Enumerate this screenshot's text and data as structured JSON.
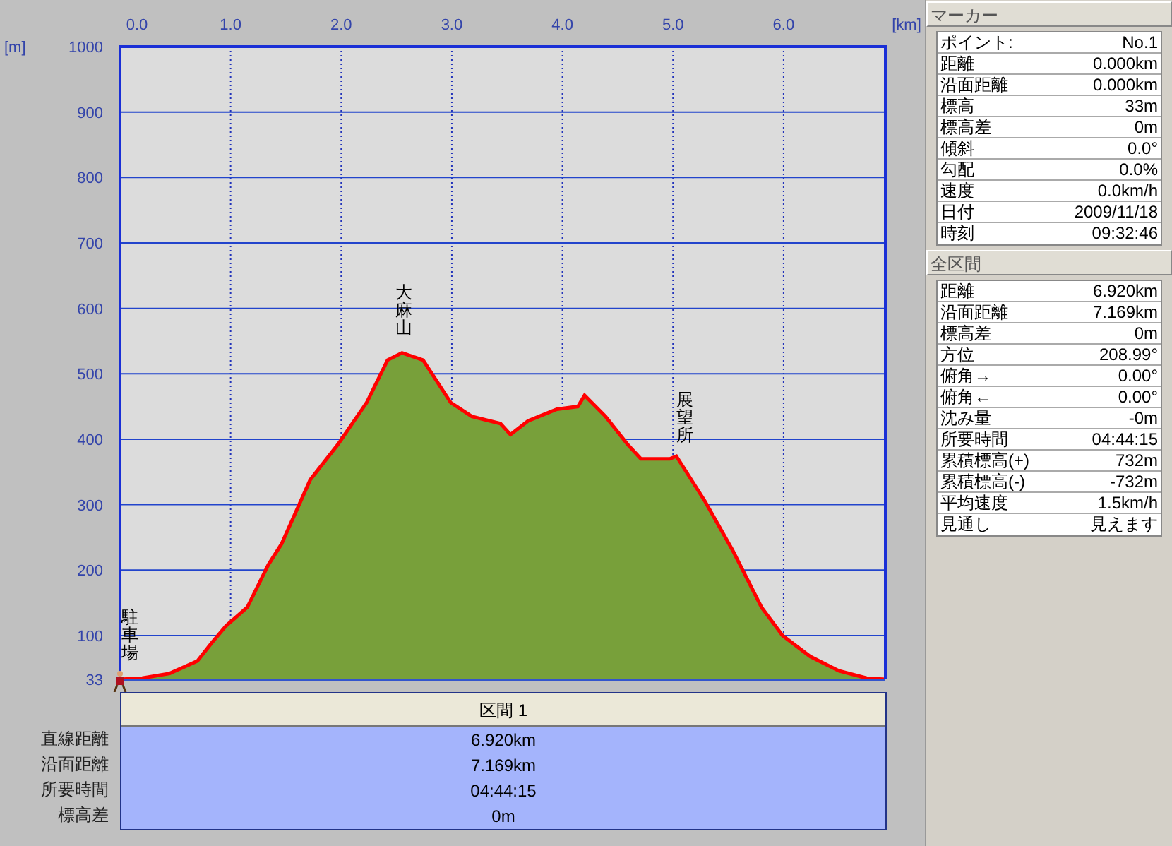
{
  "chart": {
    "chart_data": {
      "type": "area",
      "xlabel": "[km]",
      "ylabel": "[m]",
      "x": [
        0,
        0.2,
        0.45,
        0.7,
        0.83,
        0.96,
        1.15,
        1.34,
        1.46,
        1.72,
        1.97,
        2.23,
        2.42,
        2.55,
        2.74,
        2.99,
        3.18,
        3.44,
        3.53,
        3.69,
        3.95,
        4.14,
        4.2,
        4.39,
        4.59,
        4.71,
        4.97,
        5.03,
        5.29,
        5.54,
        5.8,
        5.99,
        6.24,
        6.5,
        6.75,
        6.92
      ],
      "series": [
        {
          "values": [
            33,
            35,
            42,
            61,
            89,
            115,
            143,
            208,
            240,
            338,
            392,
            456,
            521,
            532,
            521,
            456,
            435,
            424,
            407,
            428,
            446,
            450,
            467,
            435,
            392,
            370,
            370,
            374,
            305,
            230,
            143,
            100,
            68,
            46,
            35,
            33
          ]
        }
      ],
      "xlim": [
        0,
        6.92
      ],
      "ylim": [
        33,
        1000
      ],
      "xticks": [
        {
          "value": 0,
          "label": "0.0"
        },
        {
          "value": 1,
          "label": "1.0"
        },
        {
          "value": 2,
          "label": "2.0"
        },
        {
          "value": 3,
          "label": "3.0"
        },
        {
          "value": 4,
          "label": "4.0"
        },
        {
          "value": 5,
          "label": "5.0"
        },
        {
          "value": 6,
          "label": "6.0"
        }
      ],
      "yticks": [
        33,
        100,
        200,
        300,
        400,
        500,
        600,
        700,
        800,
        900,
        1000
      ],
      "grid": true,
      "annotations": [
        "駐車場",
        "大麻山",
        "展望所"
      ]
    }
  },
  "section_table": {
    "header": "区間 1",
    "rows": [
      {
        "label": "直線距離",
        "value": "6.920km"
      },
      {
        "label": "沿面距離",
        "value": "7.169km"
      },
      {
        "label": "所要時間",
        "value": "04:44:15"
      },
      {
        "label": "標高差",
        "value": "0m"
      }
    ]
  },
  "panels": [
    {
      "title": "マーカー",
      "rows": [
        {
          "label": "ポイント:",
          "value": "No.1"
        },
        {
          "label": "距離",
          "value": "0.000km"
        },
        {
          "label": "沿面距離",
          "value": "0.000km"
        },
        {
          "label": "標高",
          "value": "33m"
        },
        {
          "label": "標高差",
          "value": "0m"
        },
        {
          "label": "傾斜",
          "value": "0.0°"
        },
        {
          "label": "勾配",
          "value": "0.0%"
        },
        {
          "label": "速度",
          "value": "0.0km/h"
        },
        {
          "label": "日付",
          "value": "2009/11/18"
        },
        {
          "label": "時刻",
          "value": "09:32:46"
        }
      ]
    },
    {
      "title": "全区間",
      "rows": [
        {
          "label": "距離",
          "value": "6.920km"
        },
        {
          "label": "沿面距離",
          "value": "7.169km"
        },
        {
          "label": "標高差",
          "value": "0m"
        },
        {
          "label": "方位",
          "value": "208.99°"
        },
        {
          "label": "俯角→",
          "value": "0.00°"
        },
        {
          "label": "俯角←",
          "value": "0.00°"
        },
        {
          "label": "沈み量",
          "value": "-0m"
        },
        {
          "label": "所要時間",
          "value": "04:44:15"
        },
        {
          "label": "累積標高(+)",
          "value": "732m"
        },
        {
          "label": "累積標高(-)",
          "value": "-732m"
        },
        {
          "label": "平均速度",
          "value": "1.5km/h"
        },
        {
          "label": "見通し",
          "value": "見えます"
        }
      ]
    }
  ]
}
